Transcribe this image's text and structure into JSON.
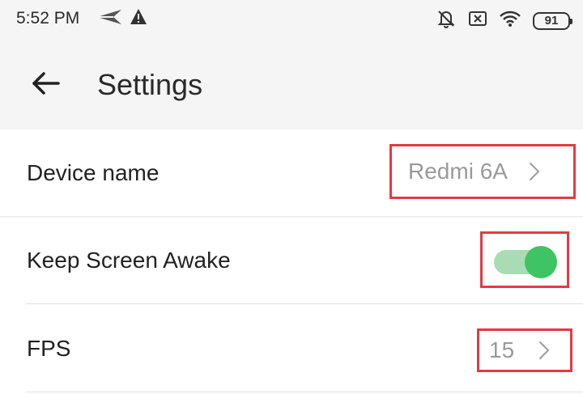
{
  "status_bar": {
    "time": "5:52 PM",
    "battery": "91",
    "left_icons": [
      "send-icon",
      "warning-icon"
    ],
    "right_icons": [
      "notifications-off-icon",
      "sim-disabled-icon",
      "wifi-icon",
      "battery-icon"
    ]
  },
  "header": {
    "title": "Settings",
    "back_icon": "arrow-back-icon"
  },
  "settings": {
    "device_name": {
      "label": "Device name",
      "value": "Redmi 6A"
    },
    "keep_awake": {
      "label": "Keep Screen Awake",
      "enabled": true
    },
    "fps": {
      "label": "FPS",
      "value": "15"
    }
  },
  "colors": {
    "highlight": "#e53945",
    "toggle_on": "#3ec462",
    "toggle_track": "#a9dcb4",
    "secondary_text": "#9a9a9a"
  }
}
